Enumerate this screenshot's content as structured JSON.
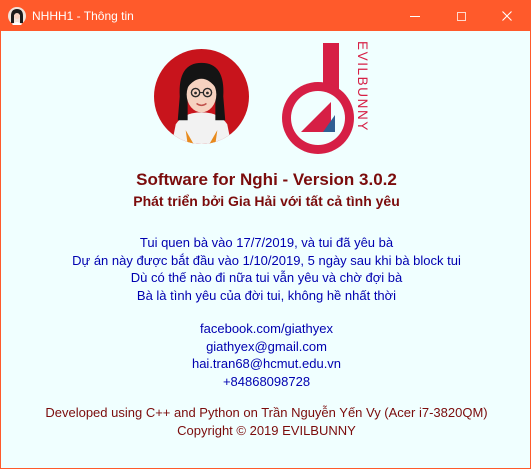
{
  "window": {
    "title": "NHHH1 - Thông tin",
    "accent_color": "#ff5a2b",
    "controls": [
      "minimize-icon",
      "maximize-icon",
      "close-icon"
    ]
  },
  "logo": {
    "wordmark": "EVILBUNNY",
    "primary_color": "#d61f45",
    "secondary_color": "#2f5f93"
  },
  "about": {
    "heading": "Software for Nghi - Version 3.0.2",
    "subheading": "Phát triển bởi Gia Hải với tất cả tình yêu",
    "story_lines": [
      "Tui quen bà vào 17/7/2019, và tui đã yêu bà",
      "Dự án này được bắt đầu vào 1/10/2019, 5 ngày sau khi bà block tui",
      "Dù có thế nào đi nữa tui vẫn yêu và chờ đợi bà",
      "Bà là tình yêu của đời tui, không hề nhất thời"
    ],
    "contacts": [
      "facebook.com/giathyex",
      "giathyex@gmail.com",
      "hai.tran68@hcmut.edu.vn",
      "+84868098728"
    ],
    "credits": [
      "Developed using C++ and Python on Trần Nguyễn Yến Vy (Acer i7-3820QM)",
      "Copyright © 2019 EVILBUNNY"
    ],
    "heading_color": "#7b0c0c",
    "body_color": "#0000b0"
  }
}
